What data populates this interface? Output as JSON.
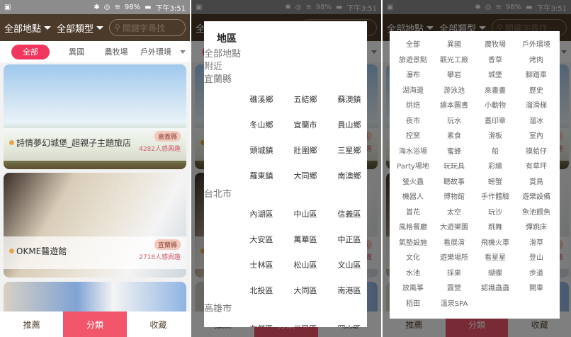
{
  "status": {
    "battery": "98%",
    "time": "下午3:51"
  },
  "header": {
    "location": "全部地點",
    "category": "全部類型",
    "search_placeholder": "關鍵字尋找"
  },
  "tabs": [
    "全部",
    "異國",
    "農牧場",
    "戶外環境"
  ],
  "cards": [
    {
      "name": "詩情夢幻城堡_超親子主題旅店",
      "region": "嘉義縣",
      "interest": "4282人感興趣"
    },
    {
      "name": "OKME醫遊館",
      "region": "宜蘭縣",
      "interest": "2718人感興趣"
    }
  ],
  "nav": [
    "推薦",
    "分類",
    "收藏"
  ],
  "region_dialog": {
    "title": "地區",
    "top_options": [
      "全部地點",
      "附近"
    ],
    "groups": [
      {
        "name": "宜蘭縣",
        "items": [
          "礁溪鄉",
          "五結鄉",
          "蘇澳鎮",
          "冬山鄉",
          "宜蘭市",
          "員山鄉",
          "頭城鎮",
          "壯圍鄉",
          "三星鄉",
          "羅東鎮",
          "大同鄉",
          "南澳鄉"
        ]
      },
      {
        "name": "台北市",
        "items": [
          "內湖區",
          "中山區",
          "信義區",
          "大安區",
          "萬華區",
          "中正區",
          "士林區",
          "松山區",
          "文山區",
          "北投區",
          "大同區",
          "南港區"
        ]
      },
      {
        "name": "高雄市",
        "items": [
          "左營區",
          "三民區",
          "岡山區"
        ]
      }
    ]
  },
  "category_dialog": {
    "items": [
      "全部",
      "異國",
      "農牧場",
      "戶外環境",
      "旅遊景點",
      "觀光工廠",
      "香草",
      "烤肉",
      "瀑布",
      "攀岩",
      "城堡",
      "腳踏車",
      "湖海邊",
      "游泳池",
      "來畫畫",
      "歷史",
      "烘焙",
      "繪本圖書",
      "小動物",
      "溜滑梯",
      "夜市",
      "玩水",
      "蓋印章",
      "溜冰",
      "控窯",
      "素食",
      "滑板",
      "室內",
      "海水浴場",
      "蜜蜂",
      "船",
      "摸蛤仔",
      "Party場地",
      "玩玩具",
      "彩繪",
      "有草坪",
      "螢火蟲",
      "聽故事",
      "螃蟹",
      "賞鳥",
      "機器人",
      "博物館",
      "手作體驗",
      "遊樂設備",
      "賞花",
      "太空",
      "玩沙",
      "魚池餵魚",
      "風格餐廳",
      "大遊樂園",
      "跳舞",
      "彈跳床",
      "氣墊設施",
      "看展演",
      "飛機火車",
      "滑草",
      "文化",
      "遊樂場所",
      "看星星",
      "登山",
      "水池",
      "採果",
      "蝴蝶",
      "步道",
      "放風箏",
      "露營",
      "認識蟲蟲",
      "開車",
      "稻田",
      "溫泉SPA"
    ]
  }
}
